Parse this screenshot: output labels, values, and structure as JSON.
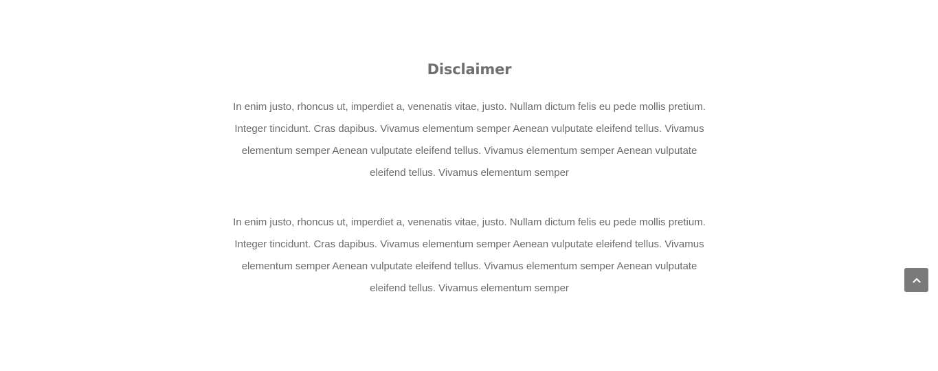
{
  "disclaimer": {
    "title": "Disclaimer",
    "paragraphs": [
      "In enim justo, rhoncus ut, imperdiet a, venenatis vitae, justo. Nullam dictum felis eu pede mollis pretium. Integer tincidunt. Cras dapibus. Vivamus elementum semper Aenean vulputate eleifend tellus. Vivamus elementum semper Aenean vulputate eleifend tellus. Vivamus elementum semper Aenean vulputate eleifend tellus. Vivamus elementum semper",
      "In enim justo, rhoncus ut, imperdiet a, venenatis vitae, justo. Nullam dictum felis eu pede mollis pretium. Integer tincidunt. Cras dapibus. Vivamus elementum semper Aenean vulputate eleifend tellus. Vivamus elementum semper Aenean vulputate eleifend tellus. Vivamus elementum semper Aenean vulputate eleifend tellus. Vivamus elementum semper"
    ]
  },
  "scroll_top": {
    "icon": "chevron-up-icon",
    "color": "#7a7a7a"
  }
}
